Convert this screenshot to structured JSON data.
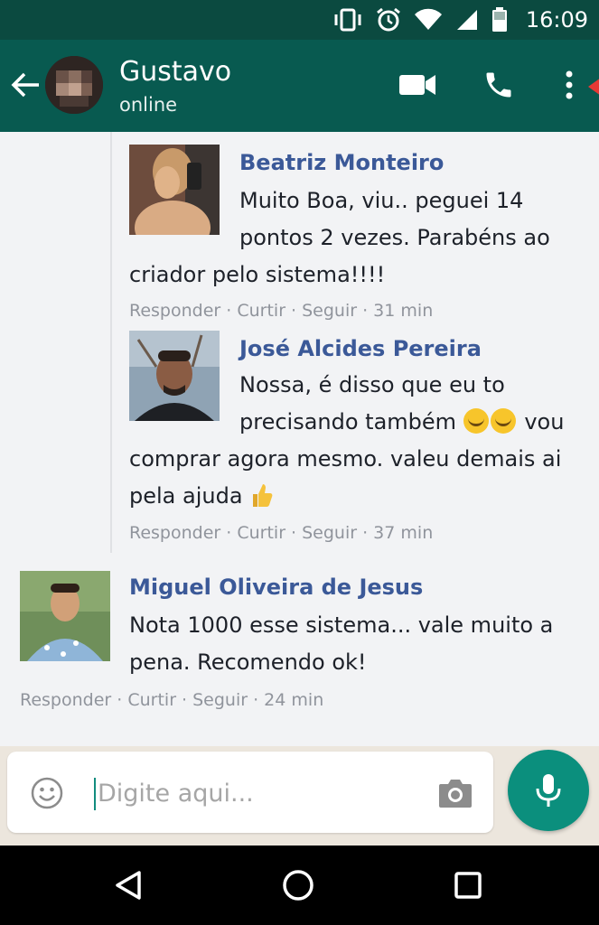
{
  "status_bar": {
    "time": "16:09",
    "icons": [
      "vibrate-icon",
      "alarm-icon",
      "wifi-icon",
      "signal-icon",
      "battery-icon"
    ]
  },
  "header": {
    "contact_name": "Gustavo",
    "contact_status": "online",
    "actions": [
      "video-call-icon",
      "phone-icon",
      "more-vert-icon"
    ],
    "background_color": "#085a50"
  },
  "comments": [
    {
      "author": "Beatriz Monteiro",
      "text_lines": [
        "Muito Boa, viu.. peguei 14",
        "pontos 2 vezes. Parabéns ao",
        "criador pelo sistema!!!!"
      ],
      "meta": "Responder · Curtir · Seguir · 31 min"
    },
    {
      "author": "José Alcides Pereira",
      "text_lines": [
        "Nossa, é disso que eu to",
        "precisando também",
        "vou",
        "comprar agora mesmo. valeu demais ai",
        "pela ajuda"
      ],
      "meta": "Responder · Curtir · Seguir · 37 min"
    },
    {
      "author": "Miguel Oliveira de Jesus",
      "text_lines": [
        "Nota 1000 esse sistema... vale muito a",
        "pena. Recomendo ok!"
      ],
      "meta": "Responder · Curtir · Seguir · 24 min"
    }
  ],
  "input": {
    "placeholder": "Digite aqui...",
    "value": ""
  },
  "colors": {
    "author_name": "#3b5998",
    "accent": "#0b8f7d"
  }
}
